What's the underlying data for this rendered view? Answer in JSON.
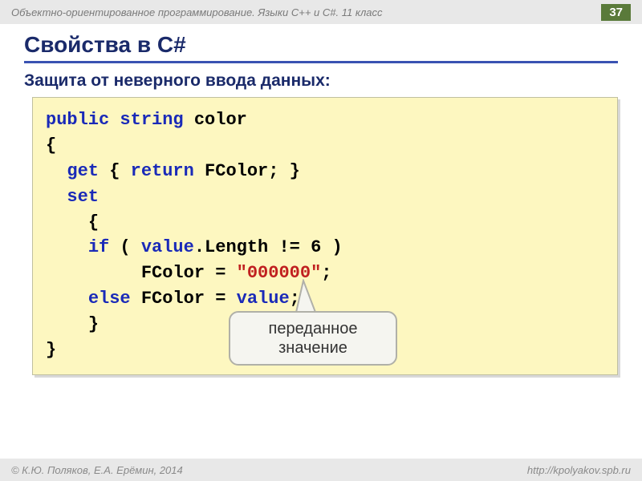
{
  "header": {
    "course": "Объектно-ориентированное программирование. Языки C++ и C#. 11 класс",
    "page": "37"
  },
  "title": "Свойства в C#",
  "subtitle": "Защита от неверного ввода данных",
  "code": {
    "l1_kw1": "public",
    "l1_kw2": "string",
    "l1_name": " color",
    "l2": "{",
    "l3_indent": "  ",
    "l3_kw1": "get",
    "l3_txt1": " { ",
    "l3_kw2": "return",
    "l3_txt2": " FColor; }",
    "l4_indent": "  ",
    "l4_kw1": "set",
    "l5_indent": "    ",
    "l5": "{",
    "l6_indent": "    ",
    "l6_kw1": "if",
    "l6_txt1": " ( ",
    "l6_kw2": "value",
    "l6_txt2": ".Length != 6 )",
    "l7_indent": "         ",
    "l7_txt1": "FColor = ",
    "l7_str": "\"000000\"",
    "l7_txt2": ";",
    "l8_indent": "    ",
    "l8_kw1": "else",
    "l8_txt1": " FColor = ",
    "l8_kw2": "value",
    "l8_txt2": ";",
    "l9_indent": "    ",
    "l9": "}",
    "l10": "}"
  },
  "callout": {
    "line1": "переданное",
    "line2": "значение"
  },
  "footer": {
    "left": "© К.Ю. Поляков, Е.А. Ерёмин, 2014",
    "right": "http://kpolyakov.spb.ru"
  }
}
